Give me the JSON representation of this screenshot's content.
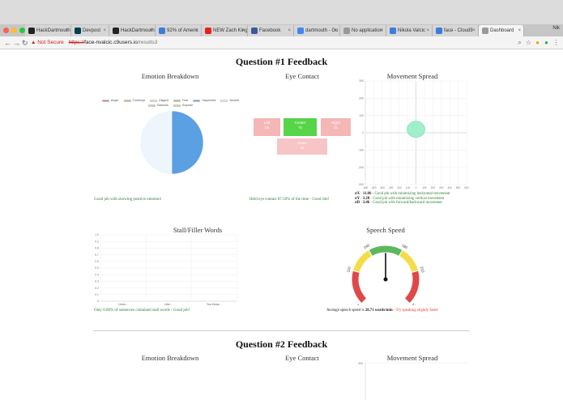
{
  "browser": {
    "tabs": [
      {
        "label": "HackDartmouth",
        "icon_color": "#222"
      },
      {
        "label": "Devpost",
        "icon_color": "#003e54"
      },
      {
        "label": "HackDartmouth",
        "icon_color": "#222"
      },
      {
        "label": "92% of Americ",
        "icon_color": "#3b7dd8"
      },
      {
        "label": "NEW Zach King",
        "icon_color": "#e62117"
      },
      {
        "label": "Facebook",
        "icon_color": "#3b5998"
      },
      {
        "label": "dartmouth - Go",
        "icon_color": "#4285f4"
      },
      {
        "label": "No application",
        "icon_color": "#999"
      },
      {
        "label": "Nikola Valcic",
        "icon_color": "#3b7dd8"
      },
      {
        "label": "face - Cloud9",
        "icon_color": "#3b7dd8"
      },
      {
        "label": "Dashboard",
        "icon_color": "#999"
      }
    ],
    "profile": "Nik",
    "not_secure": "Not Secure",
    "url_protocol": "https://",
    "url_host": "face-nvalcic.c9users.io",
    "url_path": "/results3"
  },
  "q1": {
    "title": "Question #1 Feedback",
    "emotion": {
      "title": "Emotion Breakdown",
      "legend": [
        {
          "label": "Anger",
          "color": "#e57373"
        },
        {
          "label": "Contempt",
          "color": "#f0a45c"
        },
        {
          "label": "Disgust",
          "color": "#f5e0b4"
        },
        {
          "label": "Fear",
          "color": "#7fc9c4"
        },
        {
          "label": "Happiness",
          "color": "#5d9de0"
        },
        {
          "label": "Neutral",
          "color": "#eef5fb"
        },
        {
          "label": "Sadness",
          "color": "#d0d0d0"
        },
        {
          "label": "Surprise",
          "color": "#f3d063"
        }
      ],
      "slices": [
        {
          "label": "Happiness",
          "value": 50,
          "color": "#5aa0e3"
        },
        {
          "label": "Neutral",
          "value": 50,
          "color": "#eef5fc"
        }
      ],
      "feedback": "Good job with showing positive emotion!"
    },
    "eye": {
      "title": "Eye Contact",
      "left_label": "Left",
      "left_value": "0s",
      "center_label": "Center",
      "center_value": "7s",
      "right_label": "Right",
      "right_value": "0s",
      "down_label": "Down",
      "down_value": "1s",
      "feedback": "Held eye contact 87.50% of the time - Good Job!"
    },
    "movement": {
      "title": "Movement Spread",
      "y_ticks": [
        "300",
        "200",
        "100",
        "0",
        "-100",
        "-200",
        "-300"
      ],
      "x_ticks": [
        "-600",
        "-500",
        "-400",
        "-300",
        "-200",
        "-100",
        "0",
        "100",
        "200",
        "300",
        "400",
        "500",
        "600"
      ],
      "stats": [
        {
          "label": "σX",
          "value": "11.86",
          "text": "- Good job with minimizing horizontal movement"
        },
        {
          "label": "σY",
          "value": "3.20",
          "text": "- Good job with minimizing vertical movement"
        },
        {
          "label": "σD",
          "value": "3.46",
          "text": "- Good job with forward/backward movement"
        }
      ]
    },
    "stall": {
      "title": "Stall/Filler Words",
      "feedback": "Only 0.00% of sentences contained stall words - Good job!"
    },
    "speech": {
      "title": "Speech Speed",
      "prefix": "Average speech speed is",
      "value": "28.71 words/min",
      "suffix": " - Try speaking slightly faster",
      "gauge_labels": [
        "70",
        "110",
        "140",
        "180",
        "210",
        "250"
      ]
    }
  },
  "q2": {
    "title": "Question #2 Feedback",
    "emotion_title": "Emotion Breakdown",
    "eye_title": "Eye Contact",
    "movement_title": "Movement Spread",
    "movement_top_tick": "300"
  },
  "chart_data": [
    {
      "type": "pie",
      "title": "Emotion Breakdown",
      "categories": [
        "Anger",
        "Contempt",
        "Disgust",
        "Fear",
        "Happiness",
        "Neutral",
        "Sadness",
        "Surprise"
      ],
      "values": [
        0,
        0,
        0,
        0,
        50,
        50,
        0,
        0
      ]
    },
    {
      "type": "scatter",
      "title": "Movement Spread",
      "x": [
        0
      ],
      "y": [
        20
      ],
      "xlim": [
        -600,
        600
      ],
      "ylim": [
        -300,
        300
      ]
    },
    {
      "type": "bar",
      "title": "Stall/Filler Words",
      "categories": [
        "Umm...",
        "Like...",
        "You Know..."
      ],
      "values": [
        0,
        0,
        0
      ],
      "yticks": [
        "1.0",
        "0.9",
        "0.8",
        "0.7",
        "0.6",
        "0.5",
        "0.4",
        "0.3",
        "0.2",
        "0.1",
        "0"
      ],
      "ylim": [
        0,
        1
      ]
    },
    {
      "type": "gauge",
      "title": "Speech Speed",
      "value": 28.71,
      "range": [
        70,
        250
      ],
      "ticks": [
        70,
        110,
        140,
        180,
        210,
        250
      ]
    }
  ]
}
